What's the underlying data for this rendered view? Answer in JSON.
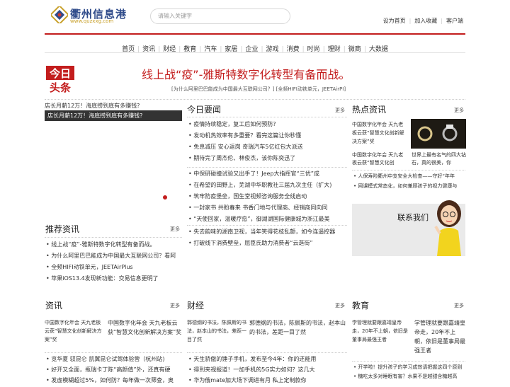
{
  "header": {
    "logo_text": "衢州信息港",
    "logo_url_text": "www.quzxxg.com",
    "search_placeholder": "请输入关键字",
    "links": [
      "设为首页",
      "加入收藏",
      "客户端"
    ]
  },
  "nav": [
    "首页",
    "资讯",
    "财经",
    "教育",
    "汽车",
    "家居",
    "企业",
    "游戏",
    "消费",
    "时尚",
    "理财",
    "微商",
    "大数据"
  ],
  "headline": {
    "badge": [
      "今日",
      "头条"
    ],
    "title": "线上战“疫”-雅斯特数字化转型有备而战。",
    "sub": "[为什么阿里巴巴能成为中国最大互联网公司？] [全频HIFI动铁单元，JEETAirPI]"
  },
  "slide": {
    "top_text": "店长月薪12万！海底捞到底有多赚钱?",
    "caption": "店长月薪12万！海底捞到底有多赚钱?"
  },
  "today": {
    "title": "今日要闻",
    "more": "更多",
    "items": [
      "疫情持续稳定，复工后如何预防?",
      "发动机热效率有多重要？看完这篇让你秒懂",
      "免息减压 安心返岗 奇瑞汽车5亿红包大派送",
      "期待完了周杰伦、林俊杰，该你陈奕迅了",
      "中保研碰撞试验又出手了！Jeep大指挥官“三优”成",
      "在希望的田野上，芜湖中华职教社三届九次主任（扩大)",
      "筑牢防疫堡垒，国生堂视频咨询服务全线启动",
      "一封家书 共盼春来 书香门地与代理商、经销商同向同",
      "“天使回家，温暖疗愈”，御湖湖国际健康城为浙江最美",
      "失去韵味的湖南卫视，当年笑得花枝乱颤，如今连遥控器",
      "打破线下消费壁垒，屈臣氏助力消费者“云逛街”"
    ]
  },
  "hot": {
    "title": "热点资讯",
    "more": "更多",
    "img1": "中国数字化年会 天九老板云获“智慧文化创新解决方案”奖",
    "cap1": "中国数字化年会 天九老板云获“智慧文化创",
    "cap2": "世界上最有名气的四大钻石，真的很美，你",
    "items": [
      "人保寿险衢州中支安全大检查——守好“年年",
      "网课模式常态化，如何兼顾孩子的视力健康与"
    ]
  },
  "contact": {
    "label": "联系我们"
  },
  "recommend": {
    "title": "推荐资讯",
    "more": "更多",
    "items": [
      "线上战“疫”-雅斯特数字化转型有备而战。",
      "为什么阿里巴巴能成为中国最大互联网公司？看阿",
      "全频HIFI动铁单元，JEETAirPlus",
      "苹果iOS13.4发现新功能：交易信息更明了"
    ]
  },
  "zixun": {
    "title": "资讯",
    "more": "更多",
    "img_alt": "中国数字化年会 天九老板云获“智慧文化创新解决方案”奖",
    "headline": "中国数字化年会 天九老板云获“智慧文化创新解决方案”奖",
    "items": [
      "览华夏 驭昆仑 凯翼昆仑试驾体验营（杭州站)",
      "好开又全面，瓶瑞卡丁陈“高颜值”外，还真有硬",
      "发虚模糊超过5%，如何防？每年做一次筛查，奥"
    ]
  },
  "caijing": {
    "title": "财经",
    "more": "更多",
    "img_alt": "郭德纲的书法，陈佩斯的书法，赵本山的书法，差距一目了然",
    "headline": "郭德纲的书法，陈佩斯的书法，赵本山的书法，差距一目了然",
    "items": [
      "天生骄傲的锤子手机，发布至今4年：你的还能用",
      "得到夹视报道！一加手机的5G实力如何？这几大",
      "华为俄mate加大场下调进有月 私上定制款你"
    ]
  },
  "jiaoyu": {
    "title": "教育",
    "more": "更多",
    "img_alt": "学管理就要跟嘉靖皇帝走，20年不上朝，依旧是董事局最强王者",
    "headline": "学管理就要跟嘉靖皇帝走，20年不上朝，依旧是董事局最强王者",
    "items": [
      "开学啦！提升孩子的学习成效请把握这四个原则",
      "糖吃太多对睡眠有害？水果不是越甜含糖越高"
    ]
  }
}
